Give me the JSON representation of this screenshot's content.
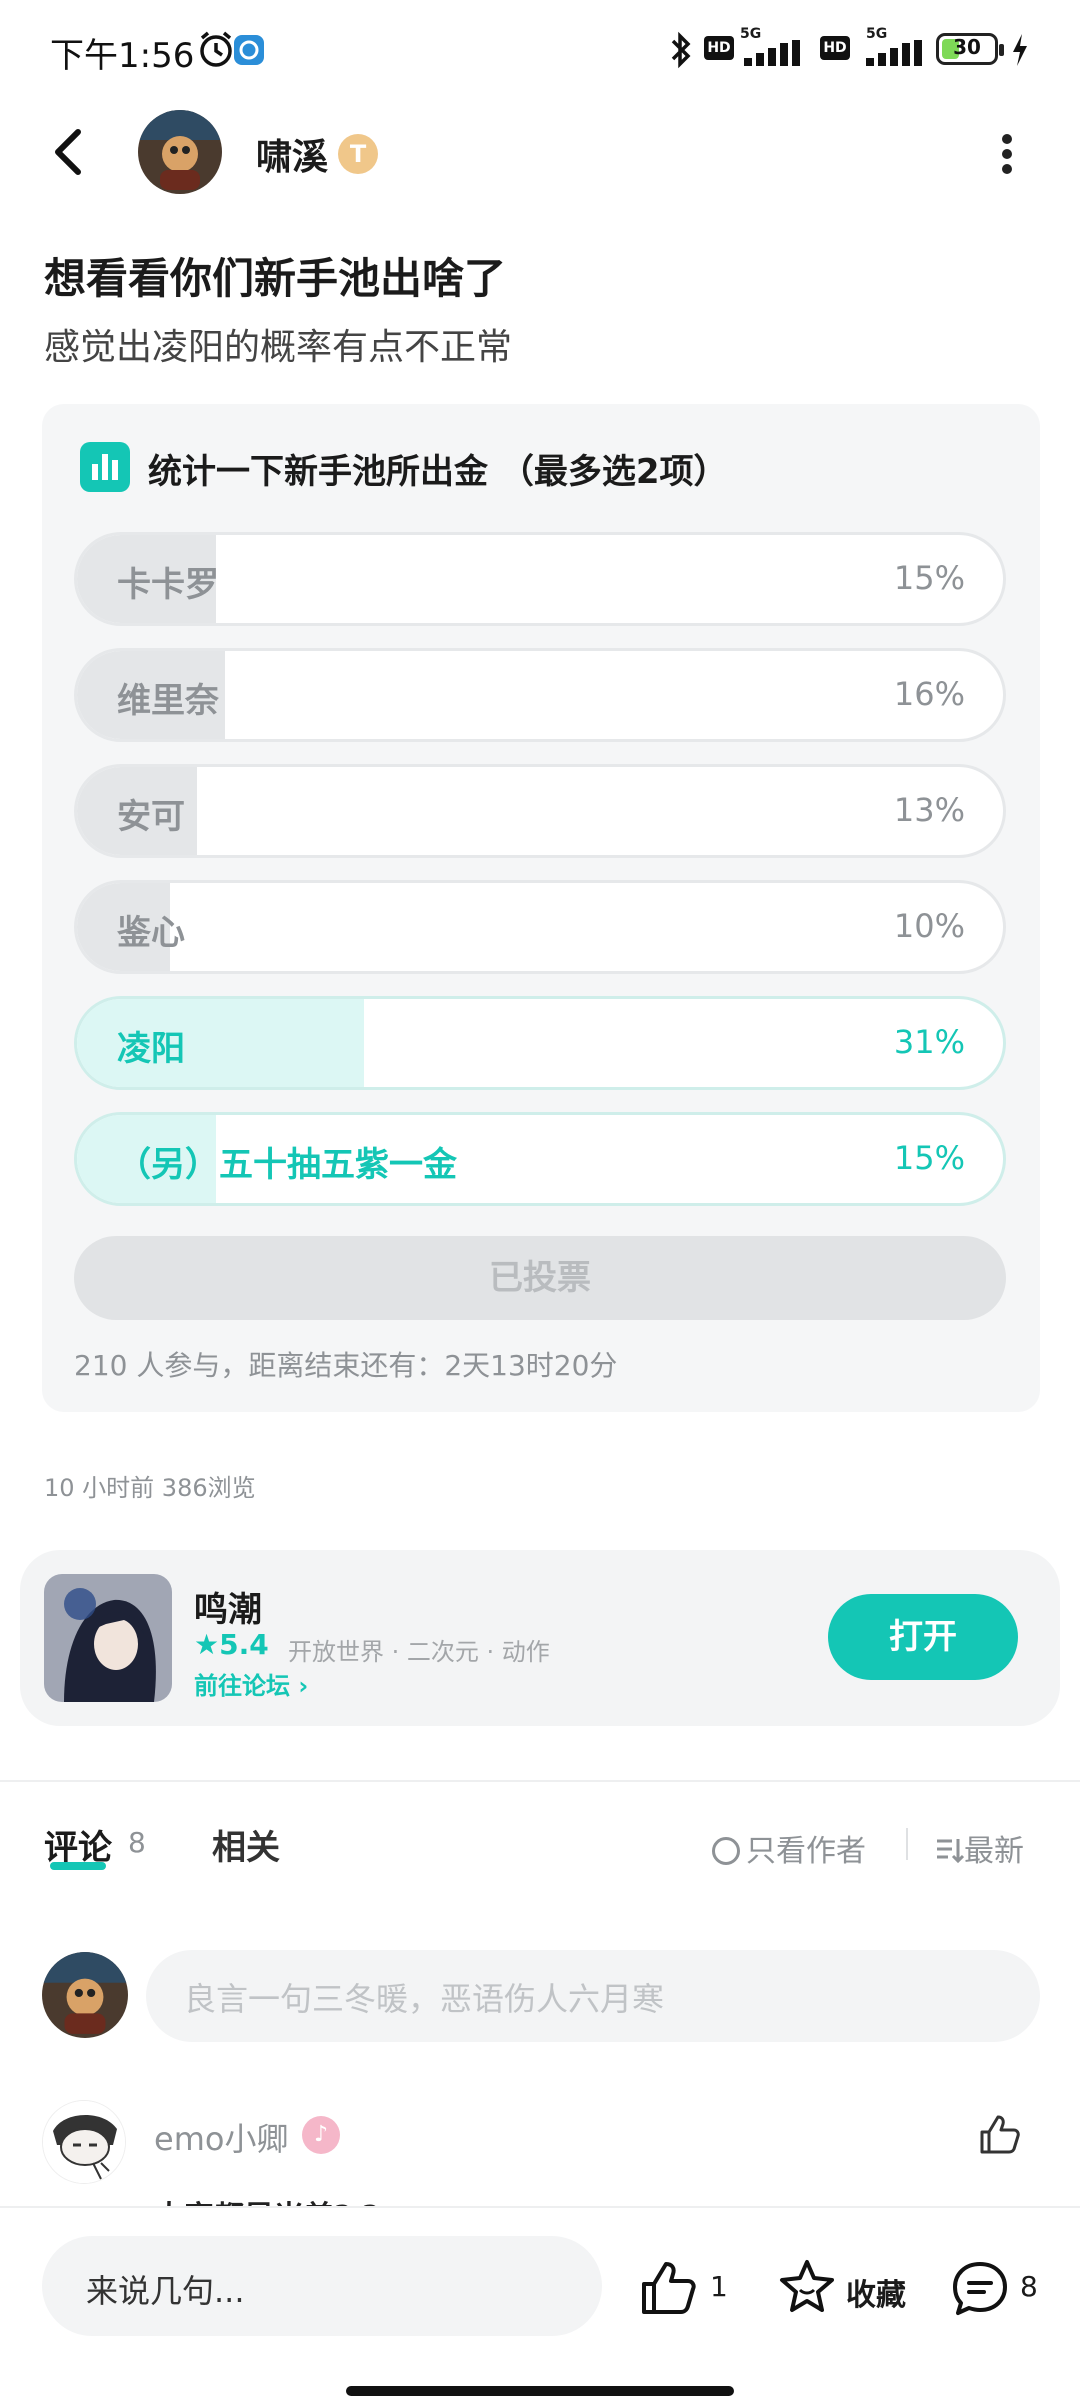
{
  "status_bar": {
    "time": "下午1:56",
    "battery": "30",
    "network_1": "5G",
    "network_2": "5G",
    "hd": "HD"
  },
  "header": {
    "author": "啸溪",
    "author_badge": "T"
  },
  "post": {
    "title": "想看看你们新手池出啥了",
    "subtitle": "感觉出凌阳的概率有点不正常"
  },
  "poll": {
    "title": "统计一下新手池所出金 （最多选2项）",
    "options": [
      {
        "label": "卡卡罗",
        "percent": "15%",
        "value": 0.15,
        "selected": false
      },
      {
        "label": "维里奈",
        "percent": "16%",
        "value": 0.16,
        "selected": false
      },
      {
        "label": "安可",
        "percent": "13%",
        "value": 0.13,
        "selected": false
      },
      {
        "label": "鉴心",
        "percent": "10%",
        "value": 0.1,
        "selected": false
      },
      {
        "label": "凌阳",
        "percent": "31%",
        "value": 0.31,
        "selected": true
      },
      {
        "label": "（另）五十抽五紫一金",
        "percent": "15%",
        "value": 0.15,
        "selected": true
      }
    ],
    "voted_label": "已投票",
    "meta": "210 人参与，距离结束还有：2天13时20分"
  },
  "post_meta": "10 小时前   386浏览",
  "game": {
    "name": "鸣潮",
    "rating": "5.4",
    "tags": "开放世界 · 二次元 · 动作",
    "forum_link": "前往论坛",
    "open_label": "打开"
  },
  "tabs": {
    "comments": "评论",
    "comments_count": "8",
    "related": "相关",
    "only_author": "只看作者",
    "latest": "最新"
  },
  "comment_input_placeholder": "良言一句三冬暖，恶语伤人六月寒",
  "comment": {
    "user": "emo小卿",
    "text": "大家都是米差? ?"
  },
  "bottom_bar": {
    "input_placeholder": "来说几句...",
    "like_count": "1",
    "favorite_label": "收藏",
    "comment_count": "8"
  },
  "colors": {
    "accent": "#14c6b5",
    "muted": "#8e9296"
  }
}
